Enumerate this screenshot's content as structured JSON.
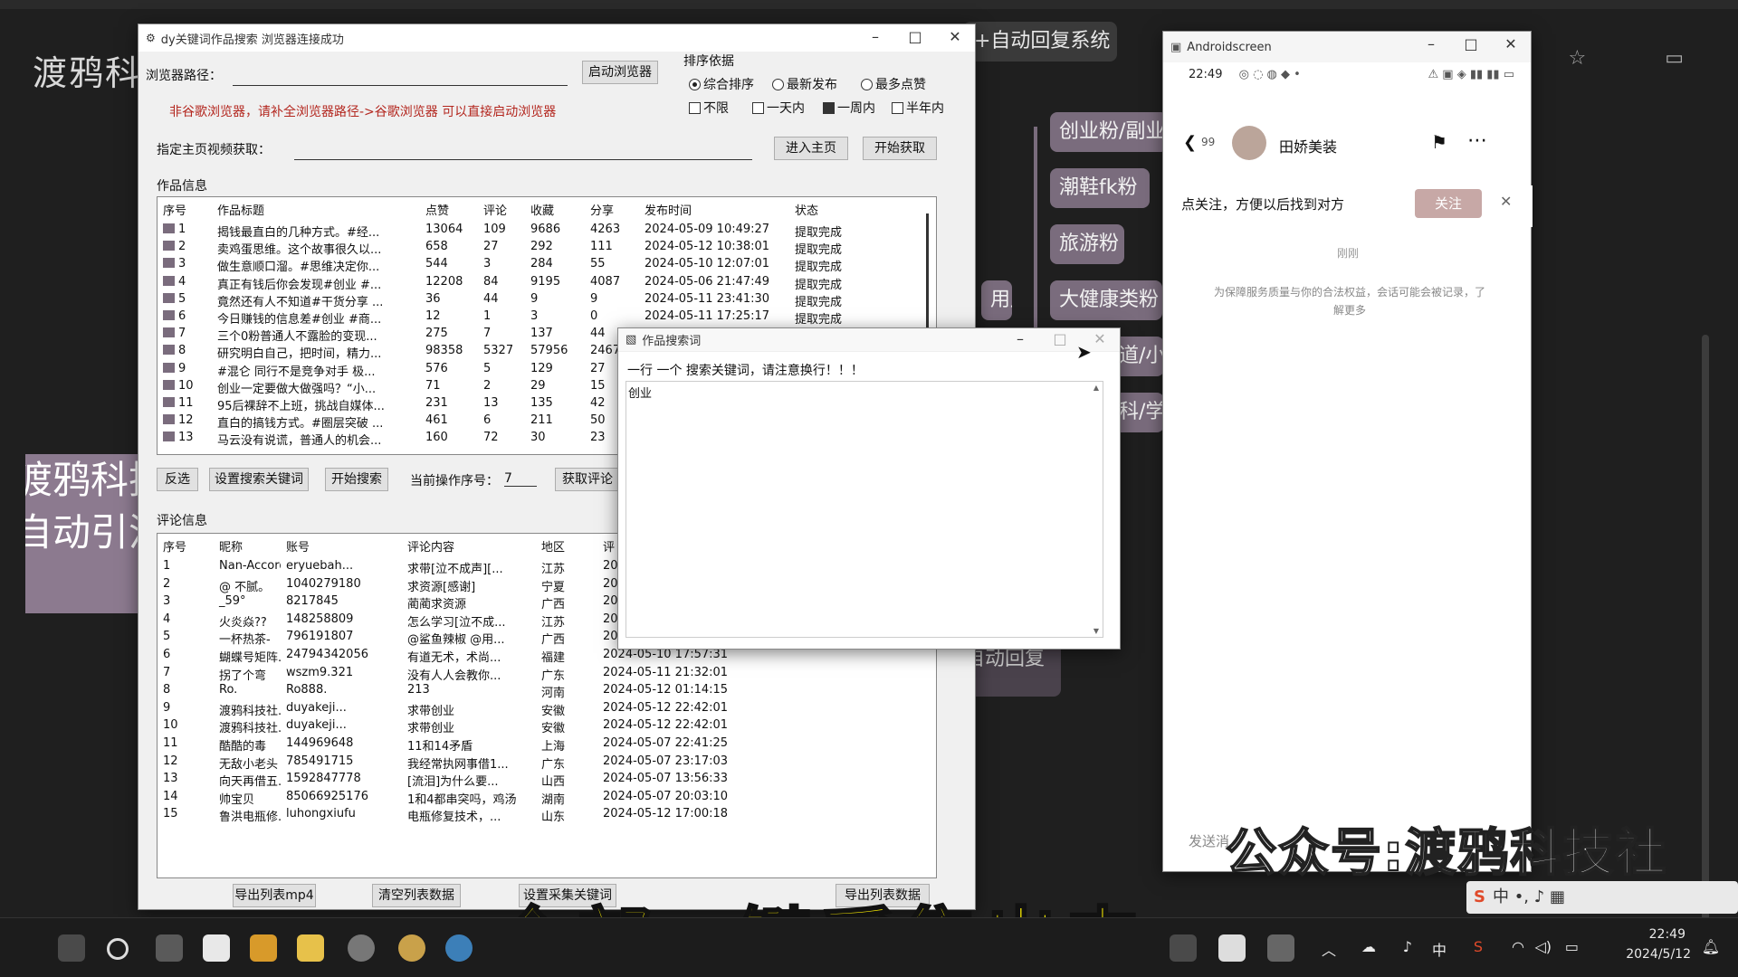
{
  "background": {
    "title": "渡鸦科",
    "top_pill": "+自动回复系统",
    "left_block_lines": [
      "渡鸦科技",
      "自动引流"
    ],
    "mindmap_nodes": [
      "创业粉/副业",
      "潮鞋fk粉",
      "旅游粉",
      "大健康类粉",
      "道/小",
      "科/学",
      "用户",
      "自动回复"
    ]
  },
  "main_window": {
    "title": "dy关键词作品搜索  浏览器连接成功",
    "browser_path_label": "浏览器路径：",
    "launch_browser": "启动浏览器",
    "hint": "非谷歌浏览器，请补全浏览器路径->谷歌浏览器 可以直接启动浏览器",
    "homepage_label": "指定主页视频获取：",
    "enter_homepage": "进入主页",
    "start_fetch": "开始获取",
    "sort_label": "排序依据",
    "sort_options": [
      {
        "label": "综合排序",
        "checked": true
      },
      {
        "label": "最新发布",
        "checked": false
      },
      {
        "label": "最多点赞",
        "checked": false
      }
    ],
    "time_options": [
      {
        "label": "不限",
        "checked": false
      },
      {
        "label": "一天内",
        "checked": false
      },
      {
        "label": "一周内",
        "checked": true
      },
      {
        "label": "半年内",
        "checked": false
      }
    ],
    "works_section": "作品信息",
    "works_headers": [
      "序号",
      "作品标题",
      "点赞",
      "评论",
      "收藏",
      "分享",
      "发布时间",
      "状态"
    ],
    "works_rows": [
      [
        "1",
        "揭钱最直白的几种方式。#经...",
        "13064",
        "109",
        "9686",
        "4263",
        "2024-05-09 10:49:27",
        "提取完成"
      ],
      [
        "2",
        "卖鸡蛋思维。这个故事很久以...",
        "658",
        "27",
        "292",
        "111",
        "2024-05-12 10:38:01",
        "提取完成"
      ],
      [
        "3",
        "做生意顺口溜。#思维决定你...",
        "544",
        "3",
        "284",
        "55",
        "2024-05-10 12:07:01",
        "提取完成"
      ],
      [
        "4",
        "真正有钱后你会发现#创业 #...",
        "12208",
        "84",
        "9195",
        "4087",
        "2024-05-06 21:47:49",
        "提取完成"
      ],
      [
        "5",
        "竟然还有人不知道#干货分享 ...",
        "36",
        "44",
        "9",
        "9",
        "2024-05-11 23:41:30",
        "提取完成"
      ],
      [
        "6",
        "今日赚钱的信息差#创业 #商...",
        "12",
        "1",
        "3",
        "0",
        "2024-05-11 17:25:17",
        "提取完成"
      ],
      [
        "7",
        "三个0粉普通人不露脸的变现...",
        "275",
        "7",
        "137",
        "44",
        "",
        ""
      ],
      [
        "8",
        "研究明白自己，把时间，精力...",
        "98358",
        "5327",
        "57956",
        "2467",
        "",
        ""
      ],
      [
        "9",
        "#混仑 同行不是竞争对手 极...",
        "576",
        "5",
        "129",
        "27",
        "",
        ""
      ],
      [
        "10",
        "创业一定要做大做强吗？“小...",
        "71",
        "2",
        "29",
        "15",
        "",
        ""
      ],
      [
        "11",
        "95后裸辞不上班，挑战自媒体...",
        "231",
        "13",
        "135",
        "42",
        "",
        ""
      ],
      [
        "12",
        "直白的搞钱方式。#圈层突破 ...",
        "461",
        "6",
        "211",
        "50",
        "",
        ""
      ],
      [
        "13",
        "马云没有说谎，普通人的机会...",
        "160",
        "72",
        "30",
        "23",
        "",
        ""
      ]
    ],
    "invert_select": "反选",
    "set_search_keywords": "设置搜索关键词",
    "start_search": "开始搜索",
    "current_op_label": "当前操作序号：",
    "current_op_value": "7",
    "get_comments": "获取评论",
    "comments_section": "评论信息",
    "comments_headers": [
      "序号",
      "昵称",
      "账号",
      "评论内容",
      "地区",
      "评"
    ],
    "comments_rows": [
      [
        "1",
        "Nan-Accord??",
        "eryuebah...",
        "求带[泣不成声][...",
        "江苏",
        "20"
      ],
      [
        "2",
        "@  不腻。",
        "1040279180",
        "求资源[感谢]",
        "宁夏",
        "20"
      ],
      [
        "3",
        "_59°",
        "8217845",
        "蔺蔺求资源",
        "广西",
        "20"
      ],
      [
        "4",
        "火炎焱??",
        "148258809",
        "怎么学习[泣不成...",
        "江苏",
        "20"
      ],
      [
        "5",
        "一杯热茶-",
        "796191807",
        "@鲨鱼辣椒 @用...",
        "广西",
        "20"
      ],
      [
        "6",
        "蝴蝶号矩阵...",
        "24794342056",
        "有道无术，术尚...",
        "福建",
        "2024-05-10 17:57:31"
      ],
      [
        "7",
        "拐了个弯",
        "wszm9.321",
        "没有人人会教你...",
        "广东",
        "2024-05-11 21:32:01"
      ],
      [
        "8",
        "Ro.",
        "Ro888.",
        "213",
        "河南",
        "2024-05-12 01:14:15"
      ],
      [
        "9",
        "渡鸦科技社...",
        "duyakeji...",
        "求带创业",
        "安徽",
        "2024-05-12 22:42:01"
      ],
      [
        "10",
        "渡鸦科技社...",
        "duyakeji...",
        "求带创业",
        "安徽",
        "2024-05-12 22:42:01"
      ],
      [
        "11",
        "酷酷的毒",
        "144969648",
        "11和14矛盾",
        "上海",
        "2024-05-07 22:41:25"
      ],
      [
        "12",
        "无敌小老头",
        "785491715",
        "我经常执网事借1...",
        "广东",
        "2024-05-07 23:17:03"
      ],
      [
        "13",
        "向天再借五...",
        "1592847778",
        "[流泪]为什么要...",
        "山西",
        "2024-05-07 13:56:33"
      ],
      [
        "14",
        "帅宝贝",
        "85066925176",
        "1和4都串突吗，鸡汤",
        "湖南",
        "2024-05-07 20:03:10"
      ],
      [
        "15",
        "鲁洪电瓶修...",
        "luhongxiufu",
        "电瓶修复技术，...",
        "山东",
        "2024-05-12 17:00:18"
      ]
    ],
    "export_mp4": "导出列表mp4",
    "clear_list": "清空列表数据",
    "set_collect_keywords": "设置采集关键词",
    "export_list": "导出列表数据"
  },
  "dialog": {
    "title": "作品搜索词",
    "note": "一行 一个 搜索关键词，请注意换行！！！",
    "keywords": "创业"
  },
  "android": {
    "title": "Androidscreen",
    "time": "22:49",
    "back_count": "99",
    "contact_name": "田娇美装",
    "follow_prompt": "点关注，方便以后找到对方",
    "follow_btn": "关注",
    "timestamp": "刚刚",
    "notice": "为保障服务质量与你的合法权益，会话可能会被记录，了解更多",
    "input_hint": "发送消"
  },
  "overlay": {
    "watermark": "公众号:渡鸦科技社",
    "caption": "全部一键采集出来",
    "ime": "中 •, ♪ ▦"
  },
  "taskbar": {
    "ime_zh": "中",
    "time": "22:49",
    "date": "2024/5/12"
  },
  "colors": {
    "accent_purple": "#7a6c7d",
    "hint_red": "#b3261e",
    "caption_yellow": "#fff200"
  }
}
